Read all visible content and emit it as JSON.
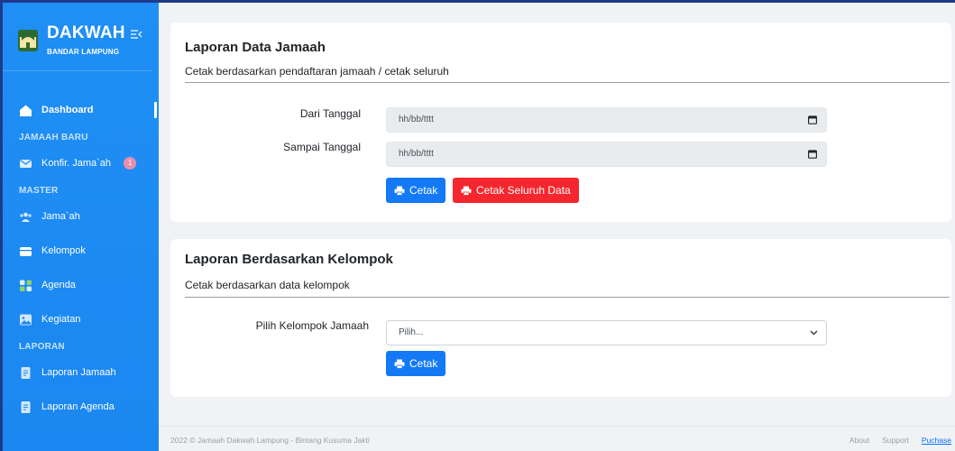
{
  "brand": {
    "title": "DAKWAH",
    "subtitle": "BANDAR LAMPUNG"
  },
  "sidebar": {
    "dashboard": "Dashboard",
    "section_jamaah_baru": "JAMAAH BARU",
    "konfir": "Konfir. Jama`ah",
    "konfir_badge": "1",
    "section_master": "MASTER",
    "jamaah": "Jama`ah",
    "kelompok": "Kelompok",
    "agenda": "Agenda",
    "kegiatan": "Kegiatan",
    "section_laporan": "LAPORAN",
    "laporan_jamaah": "Laporan Jamaah",
    "laporan_agenda": "Laporan Agenda"
  },
  "card1": {
    "title": "Laporan Data Jamaah",
    "subtitle": "Cetak berdasarkan pendaftaran jamaah / cetak seluruh",
    "from_label": "Dari Tanggal",
    "from_placeholder": "hh/bb/tttt",
    "to_label": "Sampai Tanggal",
    "to_placeholder": "hh/bb/tttt",
    "print_label": "Cetak",
    "print_all_label": "Cetak Seluruh Data"
  },
  "card2": {
    "title": "Laporan Berdasarkan Kelompok",
    "subtitle": "Cetak berdasarkan data kelompok",
    "group_label": "Pilih Kelompok Jamaah",
    "group_selected": "Pilih...",
    "print_label": "Cetak"
  },
  "footer": {
    "copyright": "2022 © Jamaah Dakwah Lampung - Bintang Kusuma Jakti",
    "about": "About",
    "support": "Support",
    "purchase": "Puchase"
  },
  "colors": {
    "sidebar": "#1b87f0",
    "primary": "#1479f5",
    "danger": "#f5262d",
    "background": "#f0f2f5"
  }
}
